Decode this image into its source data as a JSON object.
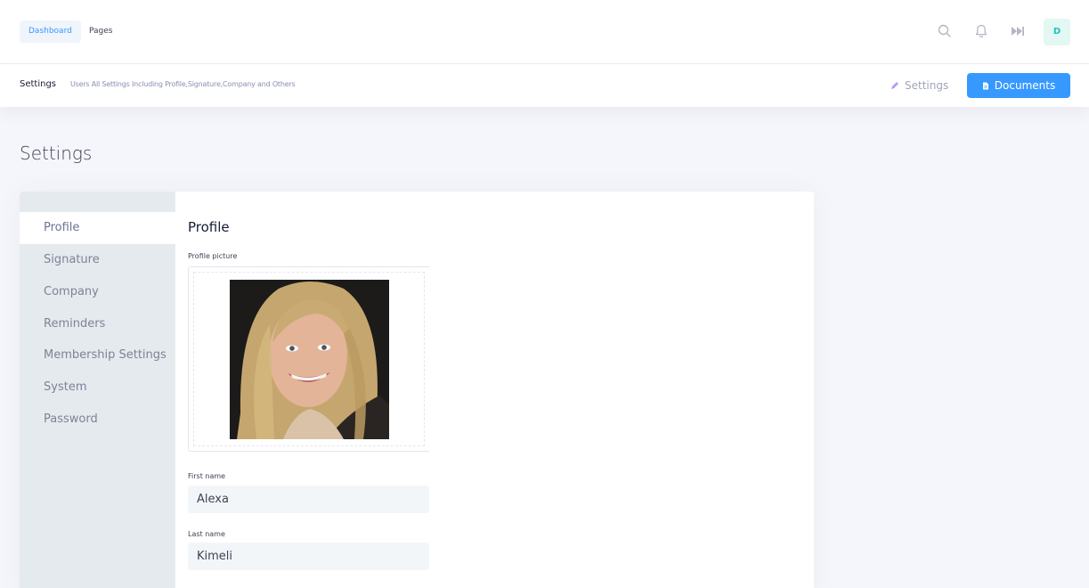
{
  "header": {
    "nav": [
      {
        "label": "Dashboard",
        "active": true
      },
      {
        "label": "Pages",
        "active": false
      }
    ],
    "icons": [
      "search-icon",
      "bell-icon",
      "fast-forward-icon"
    ],
    "user_initial": "D"
  },
  "subheader": {
    "title": "Settings",
    "description": "Users All Settings Including Profile,Signature,Company and Others",
    "settings_link": "Settings",
    "documents_button": "Documents"
  },
  "page": {
    "title": "Settings"
  },
  "sidebar": {
    "items": [
      {
        "label": "Profile",
        "active": true
      },
      {
        "label": "Signature",
        "active": false
      },
      {
        "label": "Company",
        "active": false
      },
      {
        "label": "Reminders",
        "active": false
      },
      {
        "label": "Membership Settings",
        "active": false
      },
      {
        "label": "System",
        "active": false
      },
      {
        "label": "Password",
        "active": false
      }
    ]
  },
  "profile": {
    "heading": "Profile",
    "picture_label": "Profile picture",
    "first_name_label": "First name",
    "first_name_value": "Alexa",
    "last_name_label": "Last name",
    "last_name_value": "Kimeli"
  },
  "colors": {
    "primary": "#3699ff",
    "sidebar_bg": "#e5eaee",
    "avatar_bg": "#e3f7f3",
    "avatar_fg": "#1bc5bd"
  }
}
